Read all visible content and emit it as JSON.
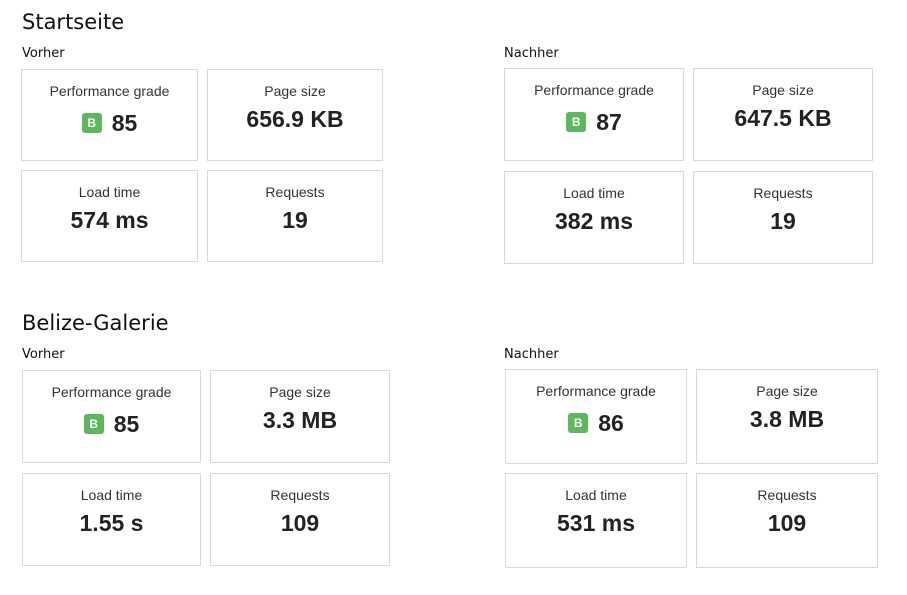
{
  "colors": {
    "grade_badge": "#5cb85c",
    "card_border": "#d8d8d8"
  },
  "sections": [
    {
      "title": "Startseite",
      "before": {
        "label": "Vorher",
        "grade_title": "Performance grade",
        "grade_letter": "B",
        "grade_score": "85",
        "size_title": "Page size",
        "size_value": "656.9 KB",
        "load_title": "Load time",
        "load_value": "574 ms",
        "req_title": "Requests",
        "req_value": "19"
      },
      "after": {
        "label": "Nachher",
        "grade_title": "Performance grade",
        "grade_letter": "B",
        "grade_score": "87",
        "size_title": "Page size",
        "size_value": "647.5 KB",
        "load_title": "Load time",
        "load_value": "382 ms",
        "req_title": "Requests",
        "req_value": "19"
      }
    },
    {
      "title": "Belize-Galerie",
      "before": {
        "label": "Vorher",
        "grade_title": "Performance grade",
        "grade_letter": "B",
        "grade_score": "85",
        "size_title": "Page size",
        "size_value": "3.3 MB",
        "load_title": "Load time",
        "load_value": "1.55 s",
        "req_title": "Requests",
        "req_value": "109"
      },
      "after": {
        "label": "Nachher",
        "grade_title": "Performance grade",
        "grade_letter": "B",
        "grade_score": "86",
        "size_title": "Page size",
        "size_value": "3.8 MB",
        "load_title": "Load time",
        "load_value": "531 ms",
        "req_title": "Requests",
        "req_value": "109"
      }
    }
  ]
}
